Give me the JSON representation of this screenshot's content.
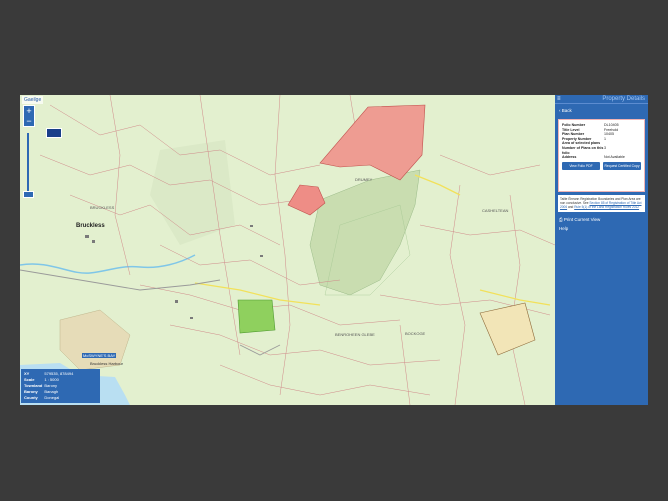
{
  "map": {
    "language_toggle": "Gaeilge",
    "zoom_in": "+",
    "zoom_out": "−",
    "places": [
      "Bruckless",
      "BRUCKLESS",
      "McSWYNE'S BAY",
      "Bruckless Harbour",
      "DRUMEY",
      "CASHELTEAN",
      "BOCKOGE",
      "BENROHEEN GLEBE"
    ],
    "info": {
      "xy_label": "XY",
      "xy_value": "579535, 878494",
      "scale_label": "Scale",
      "scale_value": "1 : 5000",
      "townland_label": "Townland",
      "townland_value": "Barony",
      "barony_label": "Barony",
      "barony_value": "Banagh",
      "county_label": "County",
      "county_value": "Donegal"
    }
  },
  "panel": {
    "title": "Property Details",
    "back": "Back",
    "fields": [
      {
        "label": "Folio Number",
        "value": "DL10405"
      },
      {
        "label": "Title Level",
        "value": "Freehold"
      },
      {
        "label": "Plan Number",
        "value": "10405"
      },
      {
        "label": "Property Number",
        "value": "1"
      },
      {
        "label": "Area of selected plans",
        "value": ""
      },
      {
        "label": "Number of Plans on this folio",
        "value": "3"
      },
      {
        "label": "Address",
        "value": "Not Available"
      }
    ],
    "view_folio_btn": "View Folio PDF",
    "certified_copy_btn": "Request Certified Copy",
    "note_text": "Tailte Éireann Registration Boundaries and Plan Area are non conclusive. See",
    "note_link1": "Section 85 of Registration of Title Act 2006",
    "note_and": "and",
    "note_link2": "Rule 5(1) of the Land Registration Rules 2012",
    "print_view": "Print Current View",
    "help": "Help"
  }
}
